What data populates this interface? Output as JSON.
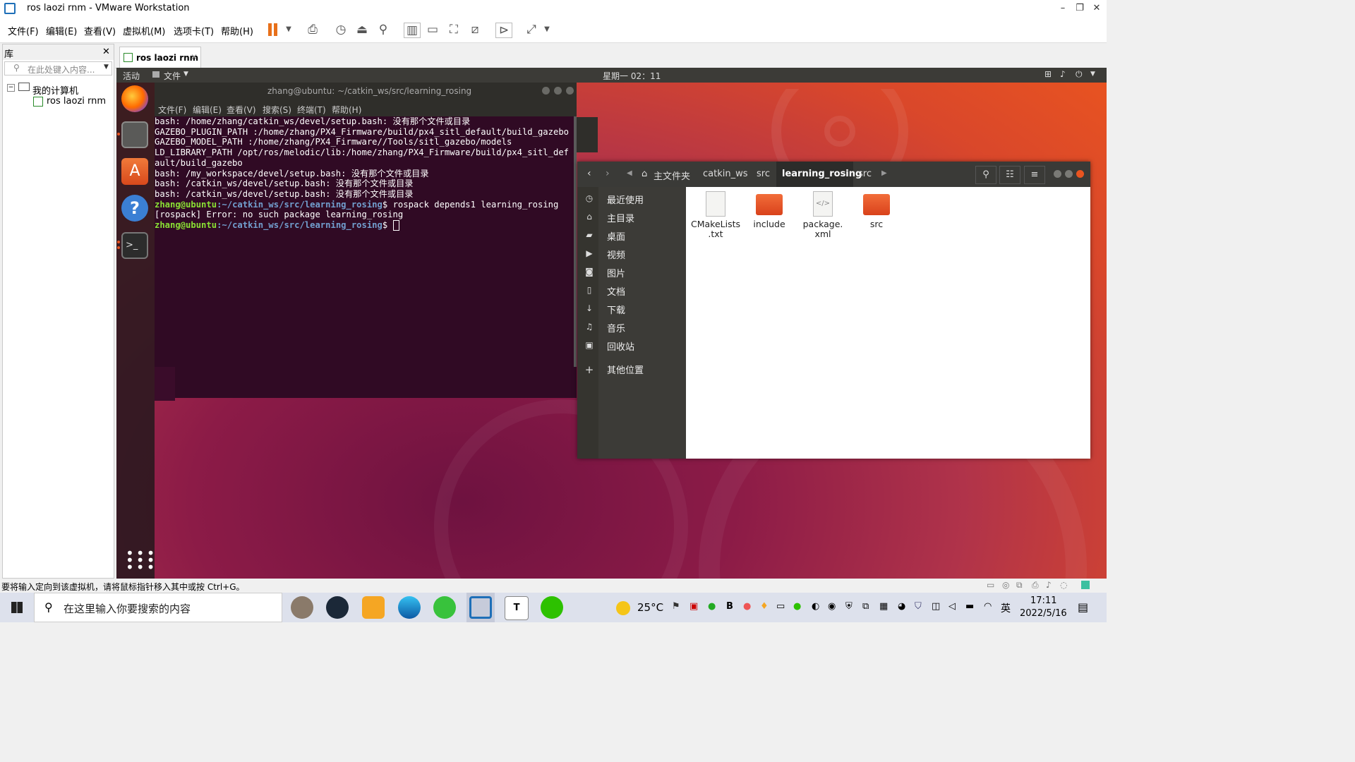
{
  "window": {
    "title": "ros laozi rnm - VMware Workstation",
    "minimize": "–",
    "maximize": "❐",
    "close": "✕"
  },
  "menubar": {
    "items": [
      "文件(F)",
      "编辑(E)",
      "查看(V)",
      "虚拟机(M)",
      "选项卡(T)",
      "帮助(H)"
    ]
  },
  "library": {
    "title": "库",
    "close": "✕",
    "search_placeholder": "在此处键入内容...",
    "tree_root": "我的计算机",
    "tree_child": "ros laozi rnm",
    "expander": "−"
  },
  "vm_tab": {
    "label": "ros laozi rnm",
    "close": "✕"
  },
  "guest_topbar": {
    "activities": "活动",
    "app_menu": "文件",
    "clock": "星期一 02：11"
  },
  "terminal": {
    "title": "zhang@ubuntu: ~/catkin_ws/src/learning_rosing",
    "menu": [
      "文件(F)",
      "编辑(E)",
      "查看(V)",
      "搜索(S)",
      "终端(T)",
      "帮助(H)"
    ],
    "lines": [
      "bash: /home/zhang/catkin_ws/devel/setup.bash: 没有那个文件或目录",
      "GAZEBO_PLUGIN_PATH :/home/zhang/PX4_Firmware/build/px4_sitl_default/build_gazebo",
      "GAZEBO_MODEL_PATH :/home/zhang/PX4_Firmware//Tools/sitl_gazebo/models",
      "LD_LIBRARY_PATH /opt/ros/melodic/lib:/home/zhang/PX4_Firmware/build/px4_sitl_def",
      "ault/build_gazebo",
      "bash: /my_workspace/devel/setup.bash: 没有那个文件或目录",
      "bash: /catkin_ws/devel/setup.bash: 没有那个文件或目录",
      "bash: /catkin_ws/devel/setup.bash: 没有那个文件或目录"
    ],
    "prompt_user": "zhang@ubuntu",
    "prompt_path": ":~/catkin_ws/src/learning_rosing",
    "prompt_symbol": "$ ",
    "command": "rospack depends1 learning_rosing",
    "error_line": "[rospack] Error: no such package learning_rosing"
  },
  "files": {
    "breadcrumbs": [
      "主文件夹",
      "catkin_ws",
      "src",
      "learning_rosing",
      "src"
    ],
    "active_crumb": "learning_rosing",
    "sidebar": [
      {
        "label": "最近使用",
        "icon": "clock-icon"
      },
      {
        "label": "主目录",
        "icon": "home-icon"
      },
      {
        "label": "桌面",
        "icon": "folder-icon"
      },
      {
        "label": "视频",
        "icon": "video-icon"
      },
      {
        "label": "图片",
        "icon": "camera-icon"
      },
      {
        "label": "文档",
        "icon": "document-icon"
      },
      {
        "label": "下载",
        "icon": "download-icon"
      },
      {
        "label": "音乐",
        "icon": "music-icon"
      },
      {
        "label": "回收站",
        "icon": "trash-icon"
      },
      {
        "label": "其他位置",
        "icon": "plus-icon"
      }
    ],
    "items": [
      {
        "name": "CMakeLists\n.txt",
        "type": "text"
      },
      {
        "name": "include",
        "type": "folder"
      },
      {
        "name": "package.\nxml",
        "type": "xml"
      },
      {
        "name": "src",
        "type": "folder"
      }
    ]
  },
  "statusbar": {
    "message": "要将输入定向到该虚拟机，请将鼠标指针移入其中或按 Ctrl+G。"
  },
  "taskbar": {
    "search_placeholder": "在这里输入你要搜索的内容",
    "weather": "25°C",
    "ime": "英",
    "time": "17:11",
    "date": "2022/5/16"
  },
  "colors": {
    "ubuntu_orange": "#e95420",
    "terminal_bg": "#300a24",
    "prompt_green": "#8ae234",
    "prompt_blue": "#729fcf"
  }
}
